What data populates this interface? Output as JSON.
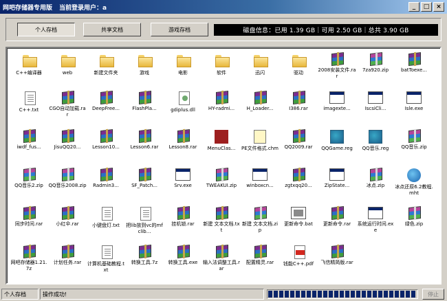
{
  "window": {
    "app_title": "网吧存储器专用版",
    "login_label": "当前登录用户：a",
    "controls": [
      "_",
      "□",
      "×"
    ]
  },
  "tabs": [
    {
      "label": "个人存档",
      "active": true
    },
    {
      "label": "共享文档",
      "active": false
    },
    {
      "label": "游戏存档",
      "active": false
    }
  ],
  "disk_info": "磁盘信息：已用 1.39 GB｜可用 2.50 GB｜总共 3.90 GB",
  "files": [
    {
      "name": "C++编译器",
      "icon": "folder"
    },
    {
      "name": "web",
      "icon": "folder"
    },
    {
      "name": "新建文件夹",
      "icon": "folder"
    },
    {
      "name": "游戏",
      "icon": "folder"
    },
    {
      "name": "电影",
      "icon": "folder"
    },
    {
      "name": "软件",
      "icon": "folder"
    },
    {
      "name": "迅闪",
      "icon": "folder"
    },
    {
      "name": "驱动",
      "icon": "folder"
    },
    {
      "name": "2008安装文件.rar",
      "icon": "rar"
    },
    {
      "name": "7za920.zip",
      "icon": "zip"
    },
    {
      "name": "batToexe...",
      "icon": "rar"
    },
    {
      "name": "C++.txt",
      "icon": "txt"
    },
    {
      "name": "CGO自动加载.rar",
      "icon": "rar"
    },
    {
      "name": "DeepFree...",
      "icon": "rar"
    },
    {
      "name": "FlashPla...",
      "icon": "rar"
    },
    {
      "name": "gdiplus.dll",
      "icon": "dll"
    },
    {
      "name": "HY-radmi...",
      "icon": "rar"
    },
    {
      "name": "H_Loader...",
      "icon": "rar"
    },
    {
      "name": "I386.rar",
      "icon": "rar"
    },
    {
      "name": "imagexte...",
      "icon": "exe"
    },
    {
      "name": "IscsiCli...",
      "icon": "exe"
    },
    {
      "name": "Isle.exe",
      "icon": "exe"
    },
    {
      "name": "iwdf_fus...",
      "icon": "rar"
    },
    {
      "name": "JisuQQ20...",
      "icon": "rar"
    },
    {
      "name": "Lesson10...",
      "icon": "rar"
    },
    {
      "name": "Lesson6.rar",
      "icon": "rar"
    },
    {
      "name": "Lesson8.rar",
      "icon": "rar"
    },
    {
      "name": "MenuClas...",
      "icon": "dat"
    },
    {
      "name": "PE文件格式.chm",
      "icon": "chm"
    },
    {
      "name": "QQ2009.rar",
      "icon": "rar"
    },
    {
      "name": "QQGame.reg",
      "icon": "reg"
    },
    {
      "name": "QQ音乐.reg",
      "icon": "reg"
    },
    {
      "name": "QQ音乐.zip",
      "icon": "zip"
    },
    {
      "name": "QQ音乐2.zip",
      "icon": "zip"
    },
    {
      "name": "QQ音乐2008.zip",
      "icon": "zip"
    },
    {
      "name": "Radmin3...",
      "icon": "rar"
    },
    {
      "name": "SF_Patch...",
      "icon": "rar"
    },
    {
      "name": "Srv.exe",
      "icon": "exe"
    },
    {
      "name": "TWEAKUI.zip",
      "icon": "zip"
    },
    {
      "name": "winboxcn...",
      "icon": "exe"
    },
    {
      "name": "zgtxqq20...",
      "icon": "rar"
    },
    {
      "name": "ZipState...",
      "icon": "exe"
    },
    {
      "name": "冰点.zip",
      "icon": "zip"
    },
    {
      "name": "冰点还原6.2教程.mht",
      "icon": "mht"
    },
    {
      "name": "同步时间.rar",
      "icon": "rar"
    },
    {
      "name": "小红伞.rar",
      "icon": "rar"
    },
    {
      "name": "小键盘灯.txt",
      "icon": "txt"
    },
    {
      "name": "把lib放到vc的mfclib...",
      "icon": "txt"
    },
    {
      "name": "挂机锁.rar",
      "icon": "rar"
    },
    {
      "name": "新建 文本文档.txt",
      "icon": "rar"
    },
    {
      "name": "新建 文本文档.zip",
      "icon": "zip"
    },
    {
      "name": "更新命令.bat",
      "icon": "bat"
    },
    {
      "name": "更新命令.rar",
      "icon": "rar"
    },
    {
      "name": "系统运行时间.exe",
      "icon": "exe"
    },
    {
      "name": "绿色.zip",
      "icon": "zip"
    },
    {
      "name": "网吧存储器1.21.7z",
      "icon": "rar"
    },
    {
      "name": "计划任务.rar",
      "icon": "rar"
    },
    {
      "name": "计算机基础教程.txt",
      "icon": "txt"
    },
    {
      "name": "转换工具.7z",
      "icon": "rar"
    },
    {
      "name": "转换工具.exe",
      "icon": "rar"
    },
    {
      "name": "输入法调整工具.rar",
      "icon": "rar"
    },
    {
      "name": "配置精灵.rar",
      "icon": "rar"
    },
    {
      "name": "钱能C++.pdf",
      "icon": "pdf"
    },
    {
      "name": "飞信精简版.rar",
      "icon": "rar"
    }
  ],
  "status": {
    "user": "个人存档",
    "message": "操作成功!",
    "stop_label": "停止",
    "progress": 1.0
  }
}
